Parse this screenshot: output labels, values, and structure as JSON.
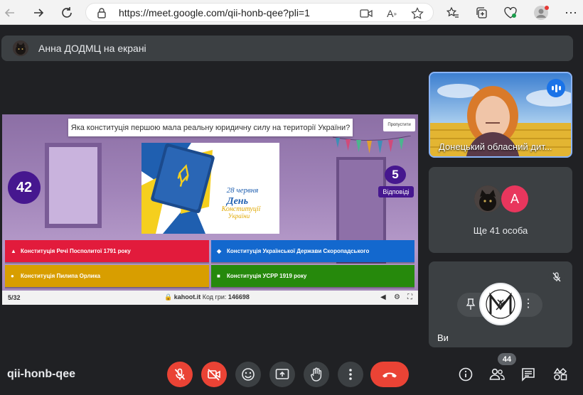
{
  "browser": {
    "url": "https://meet.google.com/qii-honb-qee?pli=1"
  },
  "presenting": {
    "text": "Анна ДОДМЦ на екрані"
  },
  "kahoot": {
    "question": "Яка конституція першою мала реальну юридичну силу на території України?",
    "skip_label": "Пропустити",
    "timer": "42",
    "answers_count": "5",
    "answers_label": "Відповіді",
    "image_caption": {
      "line1": "28 червня",
      "line2": "День",
      "line3": "Конституції",
      "line4": "України"
    },
    "answers": [
      {
        "symbol": "▲",
        "text": "Конституція Речі Посполитої 1791 року"
      },
      {
        "symbol": "◆",
        "text": "Конституція Української Держави Скоропадського"
      },
      {
        "symbol": "●",
        "text": "Конституція Пилипа Орлика"
      },
      {
        "symbol": "■",
        "text": "Конституція УСРР 1919 року"
      }
    ],
    "progress": "5/32",
    "site": "kahoot.it",
    "game_pin_label": "Код гри:",
    "game_pin": "146698"
  },
  "participants": {
    "speaker_name": "Донецький обласний дит...",
    "others_initial": "A",
    "others_label": "Ще 41 особа",
    "self_name": "Ви"
  },
  "bottom": {
    "meeting_code": "qii-honb-qee",
    "people_count": "44"
  },
  "colors": {
    "meet_bg": "#202124",
    "tile_bg": "#3c4043",
    "danger": "#ea4335",
    "kahoot_purple": "#46178f",
    "answer_red": "#e21b3c",
    "answer_blue": "#1368ce",
    "answer_yellow": "#d89e00",
    "answer_green": "#26890c"
  }
}
